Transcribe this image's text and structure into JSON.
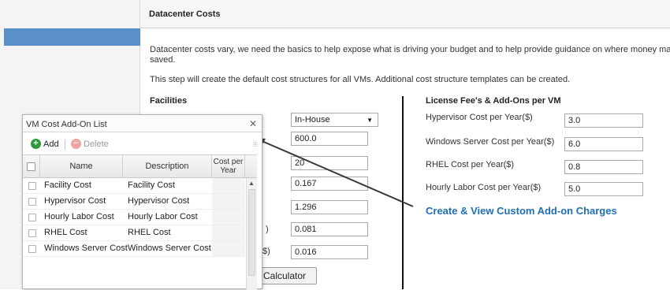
{
  "header": {
    "title": "Datacenter Costs"
  },
  "intro": {
    "line1": "Datacenter costs vary, we need the basics to help expose what is driving your budget and to help provide guidance on where money may be",
    "line1b": "saved.",
    "line2": "This step will create the default cost structures for all VMs. Additional cost structure templates can be created."
  },
  "facilities": {
    "title": "Facilities",
    "type_select": "In-House",
    "values": [
      "600.0",
      "20",
      "0.167",
      "1.296",
      "0.081",
      "0.016"
    ],
    "partial_labels": [
      ")",
      "$)"
    ],
    "calculator_button": "Calculator"
  },
  "license": {
    "title": "License Fee's & Add-Ons per VM",
    "items": [
      {
        "label": "Hypervisor Cost per Year($)",
        "value": "3.0"
      },
      {
        "label": "Windows Server Cost per Year($)",
        "value": "6.0"
      },
      {
        "label": "RHEL Cost per Year($)",
        "value": "0.8"
      },
      {
        "label": "Hourly Labor Cost per Year($)",
        "value": "5.0"
      }
    ],
    "custom_link": "Create & View Custom Add-on Charges"
  },
  "dialog": {
    "title": "VM Cost Add-On List",
    "add_label": "Add",
    "delete_label": "Delete",
    "columns": [
      "Name",
      "Description",
      "Cost per Year"
    ],
    "rows": [
      {
        "name": "Facility Cost",
        "description": "Facility Cost"
      },
      {
        "name": "Hypervisor Cost",
        "description": "Hypervisor Cost"
      },
      {
        "name": "Hourly Labor Cost",
        "description": "Hourly Labor Cost"
      },
      {
        "name": "RHEL Cost",
        "description": "RHEL Cost"
      },
      {
        "name": "Windows Server Cost",
        "description": "Windows Server Cost"
      }
    ]
  },
  "icons": {
    "close": "close-icon",
    "add": "plus-circle-icon",
    "delete": "minus-circle-icon",
    "menu": "column-menu-icon"
  },
  "colors": {
    "selected_nav": "#5b8fc9",
    "link": "#1f6fb2",
    "add_green": "#2e9b3a",
    "delete_red": "#f0a3a3"
  }
}
